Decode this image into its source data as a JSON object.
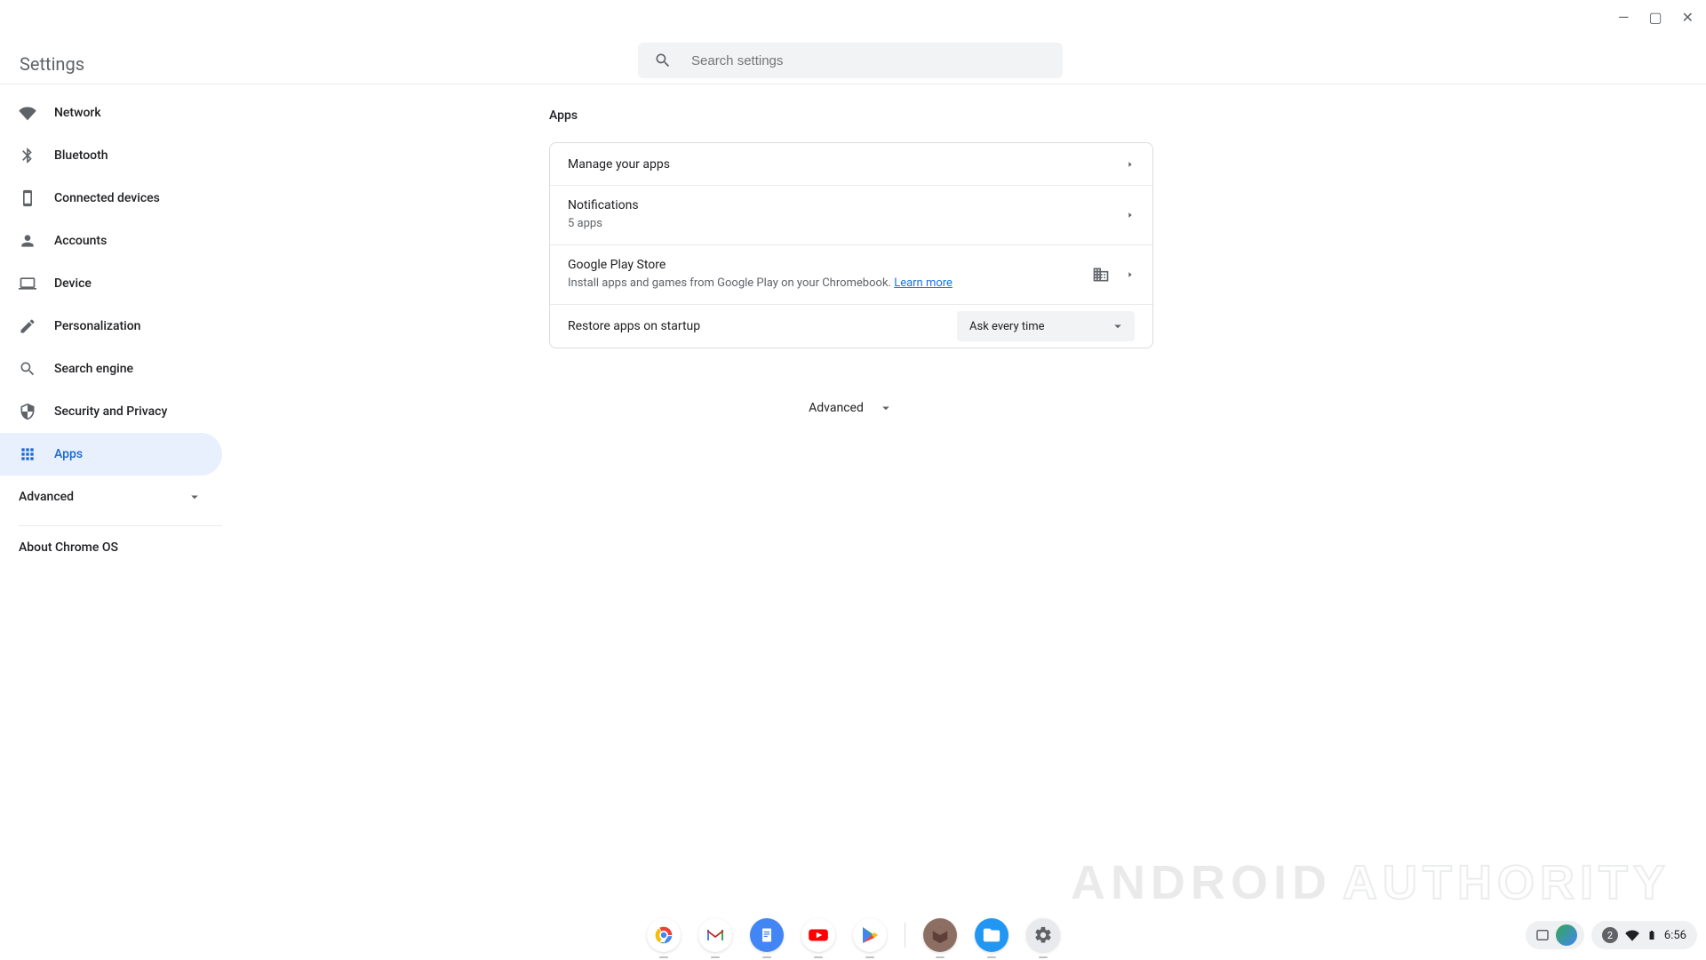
{
  "window": {
    "app_title": "Settings"
  },
  "search": {
    "placeholder": "Search settings"
  },
  "sidebar": {
    "items": [
      {
        "label": "Network"
      },
      {
        "label": "Bluetooth"
      },
      {
        "label": "Connected devices"
      },
      {
        "label": "Accounts"
      },
      {
        "label": "Device"
      },
      {
        "label": "Personalization"
      },
      {
        "label": "Search engine"
      },
      {
        "label": "Security and Privacy"
      },
      {
        "label": "Apps"
      }
    ],
    "advanced_label": "Advanced",
    "about_label": "About Chrome OS"
  },
  "main": {
    "section_title": "Apps",
    "rows": {
      "manage": {
        "title": "Manage your apps"
      },
      "notifications": {
        "title": "Notifications",
        "sub": "5 apps"
      },
      "play": {
        "title": "Google Play Store",
        "sub": "Install apps and games from Google Play on your Chromebook. ",
        "link": "Learn more"
      },
      "restore": {
        "title": "Restore apps on startup",
        "dropdown_value": "Ask every time"
      }
    },
    "advanced_label": "Advanced"
  },
  "shelf": {
    "app_names": [
      "Chrome",
      "Gmail",
      "Docs",
      "YouTube",
      "Play Store",
      "App",
      "Files",
      "Settings"
    ]
  },
  "status": {
    "count_badge": "2",
    "time": "6:56"
  },
  "watermark": {
    "part1": "ANDROID",
    "part2": "AUTHORITY"
  }
}
